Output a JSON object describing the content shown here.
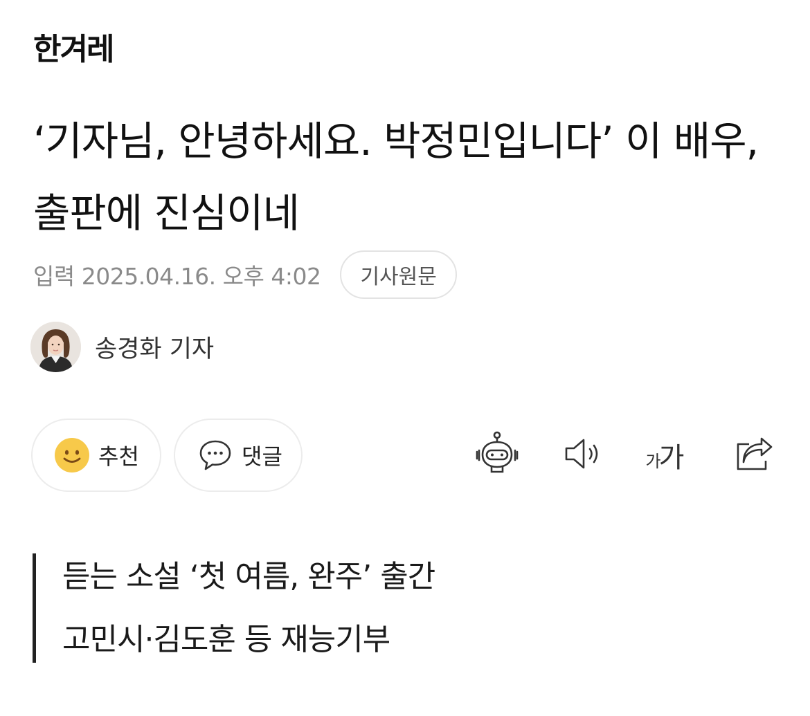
{
  "brand": {
    "logo_text": "한겨레"
  },
  "article": {
    "headline": "‘기자님, 안녕하세요. 박정민입니다’ 이 배우, 출판에 진심이네",
    "date_text": "입력 2025.04.16. 오후 4:02",
    "source_button_label": "기사원문"
  },
  "author": {
    "name": "송경화 기자"
  },
  "actions": {
    "recommend": {
      "label": "추천",
      "icon": "smile-icon"
    },
    "comment": {
      "label": "댓글",
      "icon": "speech-bubble-icon"
    }
  },
  "tools": {
    "ai_summary_icon": "robot-icon",
    "tts_icon": "speaker-icon",
    "font_size": {
      "small": "가",
      "big": "가"
    },
    "share_icon": "share-icon"
  },
  "summary": {
    "lines": [
      "듣는 소설 ‘첫 여름, 완주’ 출간",
      "고민시·김도훈 등 재능기부"
    ]
  },
  "colors": {
    "text": "#111111",
    "meta_text": "#8a8a8a",
    "border": "#e3e3e3",
    "smile_face": "#f7c94a"
  }
}
